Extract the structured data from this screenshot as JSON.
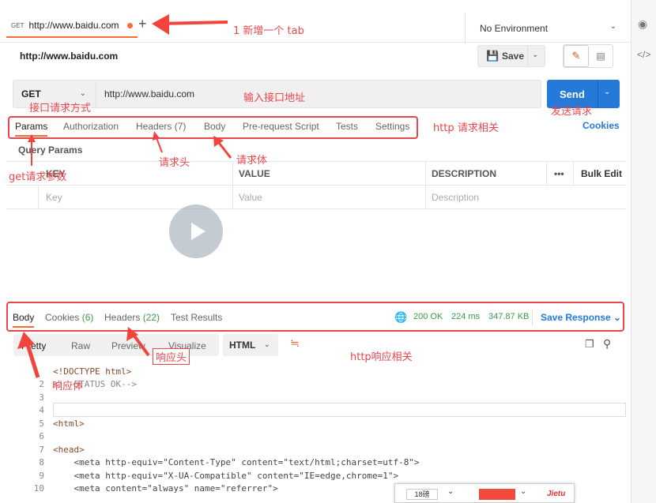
{
  "tab": {
    "method": "GET",
    "url": "http://www.baidu.com"
  },
  "environment": "No Environment",
  "title": "http://www.baidu.com",
  "save_label": "Save",
  "request": {
    "method": "GET",
    "url": "http://www.baidu.com",
    "send_label": "Send"
  },
  "req_tabs": [
    "Params",
    "Authorization",
    "Headers (7)",
    "Body",
    "Pre-request Script",
    "Tests",
    "Settings"
  ],
  "cookies_link": "Cookies",
  "query_params_label": "Query Params",
  "params_table": {
    "headers": [
      "KEY",
      "VALUE",
      "DESCRIPTION",
      "•••",
      "Bulk Edit"
    ],
    "placeholders": [
      "Key",
      "Value",
      "Description"
    ]
  },
  "response": {
    "tabs": [
      "Body",
      "Cookies",
      "(6)",
      "Headers",
      "(22)",
      "Test Results"
    ],
    "status": "200 OK",
    "time": "224 ms",
    "size": "347.87 KB",
    "save_response": "Save Response",
    "formats": [
      "Pretty",
      "Raw",
      "Preview",
      "Visualize"
    ],
    "language": "HTML"
  },
  "code_lines": [
    {
      "n": "",
      "t": "<!DOCTYPE html>"
    },
    {
      "n": "2",
      "t": "<!--STATUS OK-->"
    },
    {
      "n": "3",
      "t": ""
    },
    {
      "n": "4",
      "t": ""
    },
    {
      "n": "5",
      "t": "<html>"
    },
    {
      "n": "6",
      "t": ""
    },
    {
      "n": "7",
      "t": "<head>"
    },
    {
      "n": "8",
      "t": "    <meta http-equiv=\"Content-Type\" content=\"text/html;charset=utf-8\">"
    },
    {
      "n": "9",
      "t": "    <meta http-equiv=\"X-UA-Compatible\" content=\"IE=edge,chrome=1\">"
    },
    {
      "n": "10",
      "t": "    <meta content=\"always\" name=\"referrer\">"
    }
  ],
  "annotations": {
    "new_tab": "1 新增一个 tab",
    "method": "接口请求方式",
    "url": "输入接口地址",
    "send": "发送请求",
    "http_request": "http 请求相关",
    "get_params": "get请求参数",
    "req_headers": "请求头",
    "req_body": "请求体",
    "http_response": "http响应相关",
    "resp_headers": "响应头",
    "resp_body": "响应体"
  },
  "jietu": {
    "font_size": "18磅",
    "brand": "Jietu"
  },
  "colors": {
    "accent": "#ff6c37",
    "send": "#2479d9",
    "annotation": "#e8474c",
    "status_green": "#3a9a4a"
  }
}
